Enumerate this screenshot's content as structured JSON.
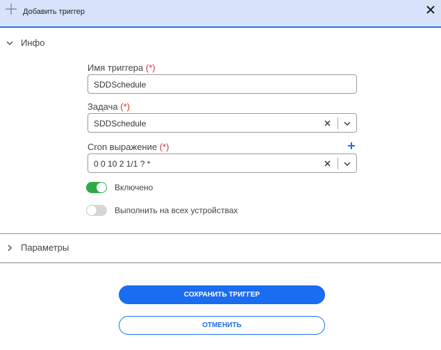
{
  "dialog": {
    "title": "Добавить триггер",
    "close_icon": "close-icon",
    "add_icon": "plus-icon"
  },
  "sections": {
    "info": {
      "label": "Инфо",
      "expanded": true
    },
    "params": {
      "label": "Параметры",
      "expanded": false
    }
  },
  "fields": {
    "trigger_name": {
      "label": "Имя триггера",
      "required_mark": "(*)",
      "value": "SDDSchedule"
    },
    "task": {
      "label": "Задача",
      "required_mark": "(*)",
      "value": "SDDSchedule"
    },
    "cron": {
      "label": "Cron выражение",
      "required_mark": "(*)",
      "value": "0 0 10 2 1/1 ? *"
    }
  },
  "toggles": {
    "enabled": {
      "label": "Включено",
      "on": true
    },
    "all_devices": {
      "label": "Выполнить на всех устройствах",
      "on": false
    }
  },
  "buttons": {
    "save": "СОХРАНИТЬ ТРИГГЕР",
    "cancel": "ОТМЕНИТЬ"
  },
  "colors": {
    "accent": "#1a6cf0",
    "header_bg": "#d7e3fa",
    "toggle_on": "#2eaa4a",
    "required": "#d32f2f"
  }
}
